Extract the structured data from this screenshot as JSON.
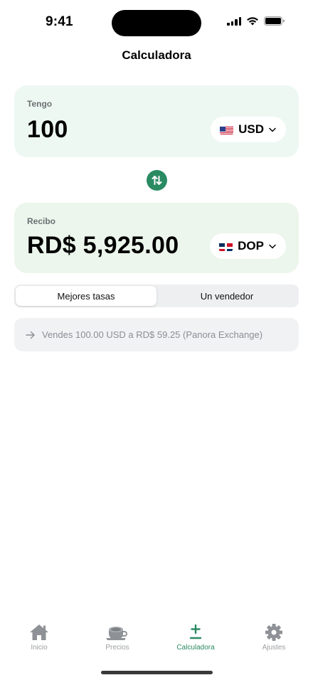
{
  "status_bar": {
    "time": "9:41"
  },
  "nav": {
    "title": "Calculadora"
  },
  "have_card": {
    "label": "Tengo",
    "amount": "100",
    "currency": "USD",
    "flag_icon": "us-flag-icon"
  },
  "receive_card": {
    "label": "Recibo",
    "amount": "RD$ 5,925.00",
    "currency": "DOP",
    "flag_icon": "do-flag-icon"
  },
  "segmented": {
    "options": [
      "Mejores tasas",
      "Un vendedor"
    ],
    "selected": "Mejores tasas"
  },
  "result": {
    "text": "Vendes 100.00 USD a RD$ 59.25 (Panora Exchange)"
  },
  "tab_bar": {
    "tabs": [
      {
        "label": "Inicio",
        "icon": "home-icon"
      },
      {
        "label": "Precios",
        "icon": "cup-icon"
      },
      {
        "label": "Calculadora",
        "icon": "plus-minus-icon"
      },
      {
        "label": "Ajustes",
        "icon": "gear-icon"
      }
    ],
    "active": "Calculadora"
  },
  "colors": {
    "accent": "#2a8a62",
    "have_bg": "#eef8f3",
    "receive_bg": "#ecf6ec"
  }
}
